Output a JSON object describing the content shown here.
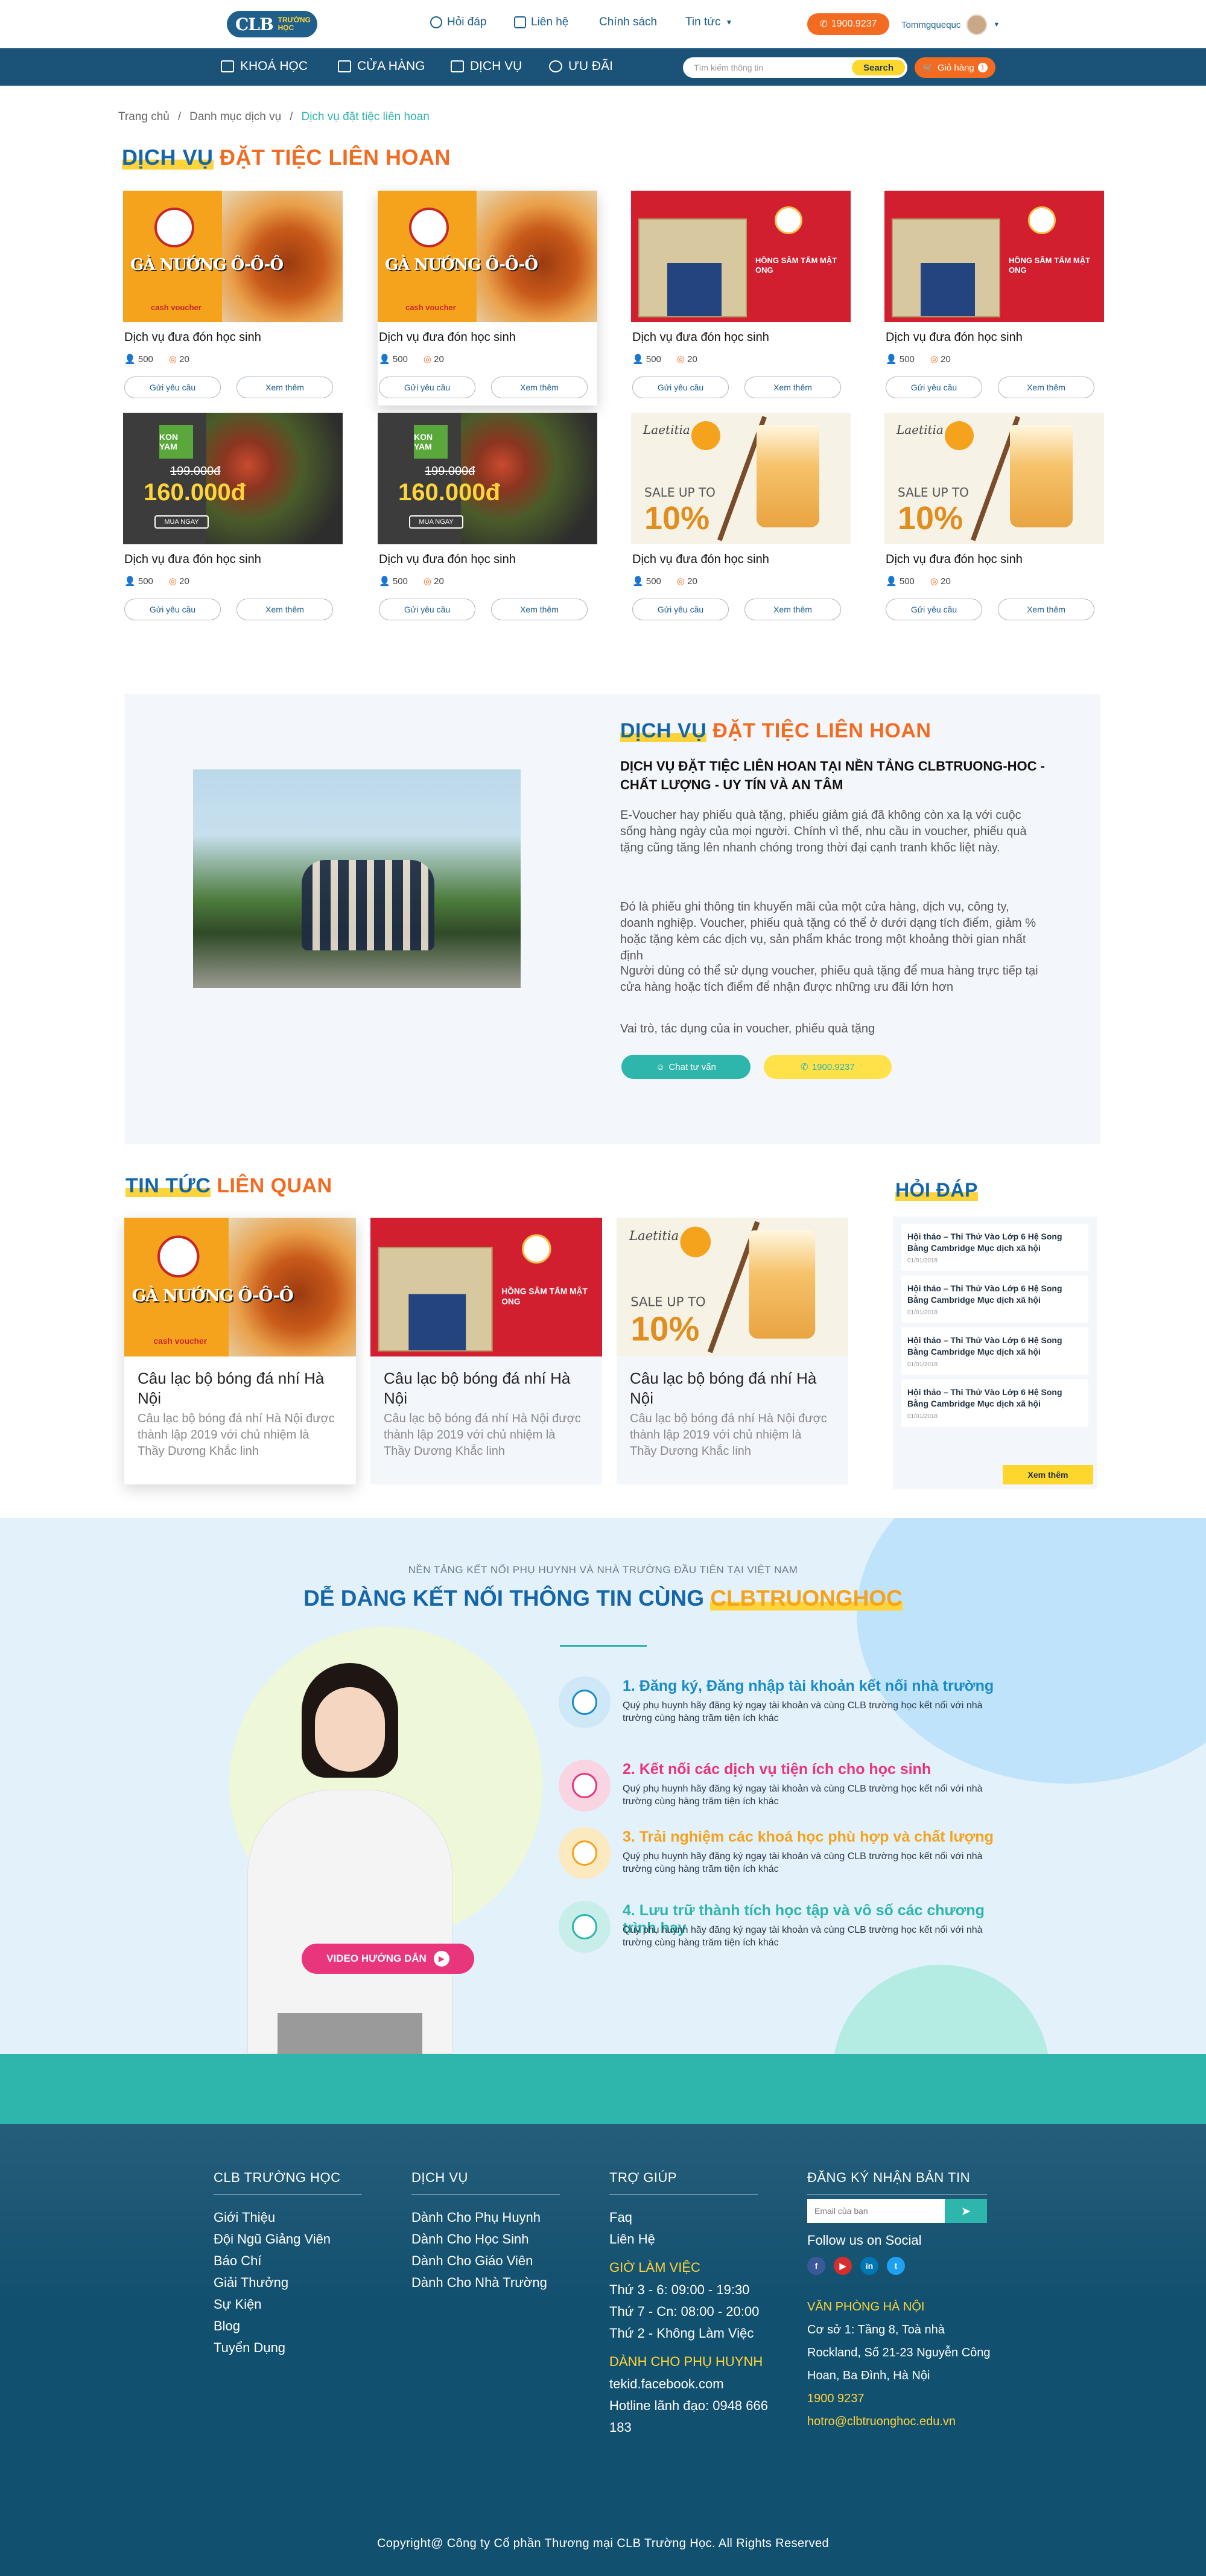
{
  "header": {
    "logo_main": "CLB",
    "logo_sub": "TRƯỜNG HỌC",
    "nav": [
      "Hỏi đáp",
      "Liên hệ",
      "Chính sách",
      "Tin tức"
    ],
    "hotline": "1900.9237",
    "username": "Tommgquequc"
  },
  "mainnav": {
    "items": [
      "KHOÁ HỌC",
      "CỬA HÀNG",
      "DỊCH VỤ",
      "ƯU ĐÃI"
    ],
    "search_placeholder": "Tìm kiếm thông tin",
    "search_button": "Search",
    "cart_label": "Giỏ hàng",
    "cart_count": "1"
  },
  "breadcrumb": [
    "Trang chủ",
    "/",
    "Danh mục dịch vụ",
    "/",
    "Dịch vụ đặt tiệc liên hoan"
  ],
  "section_title": {
    "blue": "DỊCH VỤ",
    "orange": "ĐẶT TIỆC LIÊN HOAN"
  },
  "products": {
    "art": [
      "chicken",
      "chicken",
      "ginseng",
      "ginseng",
      "bbq",
      "bbq",
      "tea",
      "tea"
    ],
    "title": "Dịch vụ đưa đón học sinh",
    "likes": "500",
    "points": "20",
    "btn_request": "Gửi yêu cầu",
    "btn_more": "Xem thêm",
    "chicken_name": "GÀ NƯỚNG Ô-Ô-Ô",
    "chicken_voucher": "cash voucher",
    "ginseng_text": "HỒNG SÂM TẨM MẬT ONG",
    "kon_brand": "KON YAM",
    "kon_old_price": "199.000đ",
    "kon_new_price": "160.000đ",
    "kon_cta": "MUA NGAY",
    "tea_brand": "Laetitia",
    "tea_sale": "SALE UP TO",
    "tea_pct": "10%"
  },
  "about": {
    "title_blue": "DỊCH VỤ",
    "title_orange": "ĐẶT TIỆC LIÊN HOAN",
    "heading": "DỊCH VỤ ĐẶT TIỆC LIÊN HOAN TẠI NỀN TẢNG CLBTRUONG-HOC - CHẤT LƯỢNG - UY TÍN VÀ AN TÂM",
    "p1": "E-Voucher hay phiếu quà tặng, phiếu giảm giá đã không còn xa lạ với cuộc sống hàng ngày của mọi người. Chính vì thế, nhu cầu in voucher, phiếu quà tặng cũng tăng lên nhanh chóng trong thời đại cạnh tranh khốc liệt này.",
    "p2": "Đó là phiếu ghi thông tin khuyến mãi của một cửa hàng, dịch vụ, công ty, doanh nghiệp. Voucher, phiếu quà tặng có thể ở dưới dạng tích điểm, giảm % hoặc tặng kèm các dịch vụ, sản phẩm khác trong một khoảng thời gian nhất định",
    "p3": "Người dùng có thể sử dụng voucher, phiếu quà tặng để mua hàng trực tiếp tại cửa hàng hoặc tích điểm để nhận được những ưu đãi lớn hơn",
    "p4": "Vai trò, tác dụng của in voucher, phiếu quà tặng",
    "btn_chat": "Chat tư vấn",
    "btn_hotline": "1900.9237"
  },
  "news": {
    "title_blue": "TIN TỨC",
    "title_orange": "LIÊN QUAN",
    "art": [
      "chicken",
      "ginseng",
      "tea"
    ],
    "headline": "Câu lạc bộ bóng đá nhí Hà Nội",
    "desc": "Câu lạc bộ bóng đá nhí Hà Nội được thành lập 2019 với chủ nhiệm là Thầy Dương Khắc linh"
  },
  "faq": {
    "title": "HỎI ĐÁP",
    "question": "Hội thảo – Thi Thử Vào Lớp 6 Hệ Song Bằng Cambridge Mục dịch xã hội",
    "date": "01/01/2018",
    "more": "Xem thêm"
  },
  "connect": {
    "sub": "NỀN TẢNG KẾT NỐI PHỤ HUYNH VÀ NHÀ TRƯỜNG ĐẦU TIÊN TẠI VIỆT NAM",
    "title": "DỄ DÀNG KẾT NỐI THÔNG TIN CÙNG",
    "title_brand": "CLBTRUONGHOC",
    "video": "VIDEO HƯỚNG DẪN",
    "steps": [
      {
        "title": "1. Đăng ký, Đăng nhập tài khoản kết nối nhà trường",
        "desc": "Quý phụ huynh hãy đăng ký ngay tài khoản và cùng CLB trường học kết nối với nhà trường cùng hàng trăm tiện ích khác",
        "color": "#1a8cc8",
        "bg": "#cfe8f7"
      },
      {
        "title": "2. Kết nối các dịch vụ tiện ích cho học sinh",
        "desc": "Quý phụ huynh hãy đăng ký ngay tài khoản và cùng CLB trường học kết nối với nhà trường cùng hàng trăm tiện ích khác",
        "color": "#e8357c",
        "bg": "#f9d5e2"
      },
      {
        "title": "3. Trải nghiệm các khoá học phù hợp và chất lượng",
        "desc": "Quý phụ huynh hãy đăng ký ngay tài khoản và cùng CLB trường học kết nối với nhà trường cùng hàng trăm tiện ích khác",
        "color": "#f5a31c",
        "bg": "#fbe9c0"
      },
      {
        "title": "4. Lưu trữ thành tích học tập và vô số các chương trình hay",
        "desc": "Quý phụ huynh hãy đăng ký ngay tài khoản và cùng CLB trường học kết nối với nhà trường cùng hàng trăm tiện ích khác",
        "color": "#2eb5ac",
        "bg": "#c8eee9"
      }
    ]
  },
  "footer": {
    "col1": {
      "title": "CLB TRƯỜNG HỌC",
      "links": [
        "Giới Thiệu",
        "Đội Ngũ Giảng Viên",
        "Báo Chí",
        "Giải Thưởng",
        "Sự Kiện",
        "Blog",
        "Tuyển Dụng"
      ]
    },
    "col2": {
      "title": "DỊCH VỤ",
      "links": [
        "Dành Cho Phụ Huynh",
        "Dành Cho Học Sinh",
        "Dành Cho Giáo Viên",
        "Dành Cho Nhà Trường"
      ]
    },
    "col3": {
      "title": "TRỢ GIÚP",
      "links": [
        "Faq",
        "Liên Hệ"
      ],
      "hours_title": "GIỜ LÀM VIỆC",
      "hours": [
        "Thứ 3 - 6: 09:00 - 19:30",
        "Thứ 7 - Cn: 08:00 - 20:00",
        "Thứ 2 - Không Làm Việc"
      ],
      "parent_title": "DÀNH CHO PHỤ HUYNH",
      "parent": [
        "tekid.facebook.com",
        "Hotline lãnh đạo: 0948 666 183"
      ]
    },
    "col4": {
      "title": "ĐĂNG KÝ NHẬN BẢN TIN",
      "email_placeholder": "Email của bạn",
      "follow": "Follow us on Social",
      "office_title": "VĂN PHÒNG HÀ NỘI",
      "address": "Cơ sở 1: Tầng 8, Toà nhà Rockland, Số 21-23 Nguyễn Công Hoan, Ba Đình, Hà Nội",
      "phone": "1900 9237",
      "email": "hotro@clbtruonghoc.edu.vn"
    },
    "copyright": "Copyright@ Công ty Cổ phần Thương mại CLB Trường Học. All Rights Reserved"
  },
  "colors": {
    "primary": "#1a5278",
    "accent": "#f26b21",
    "teal": "#2eb5ac",
    "yellow": "#ffd43b"
  }
}
